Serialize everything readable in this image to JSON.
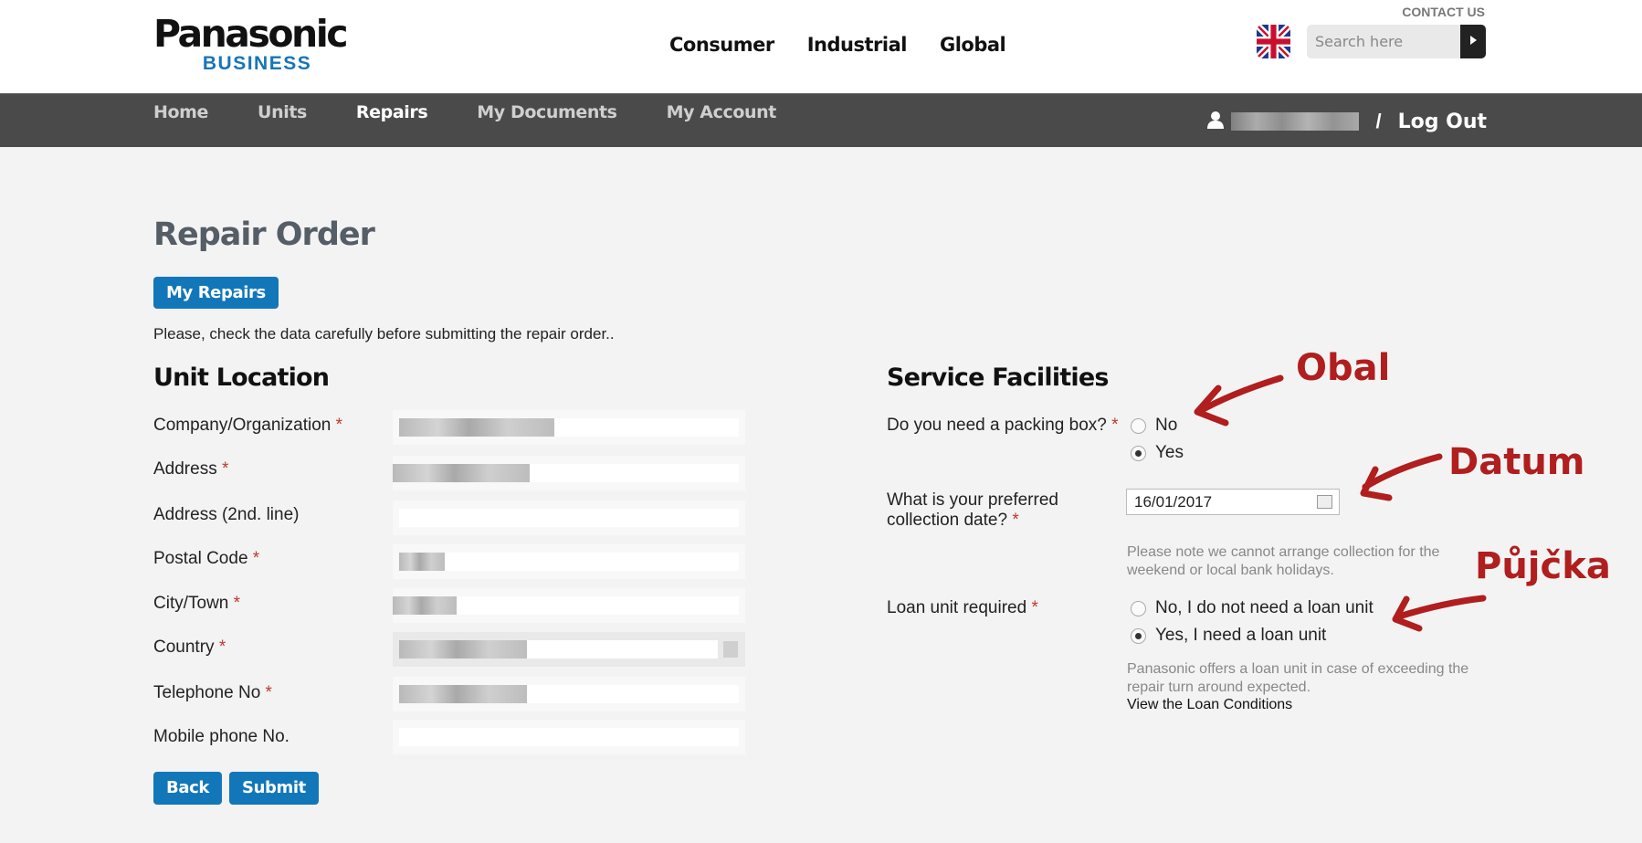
{
  "header": {
    "brand": "Panasonic",
    "brand_sub": "BUSINESS",
    "contact": "CONTACT US",
    "nav": [
      "Consumer",
      "Industrial",
      "Global"
    ],
    "search_placeholder": "Search here"
  },
  "subnav": {
    "items": [
      "Home",
      "Units",
      "Repairs",
      "My Documents",
      "My Account"
    ],
    "active": "Repairs",
    "separator": "/",
    "logout": "Log Out"
  },
  "page": {
    "title": "Repair Order",
    "my_repairs_button": "My Repairs",
    "intro": "Please, check the data carefully before submitting the repair order..",
    "back_button": "Back",
    "submit_button": "Submit"
  },
  "unit_location": {
    "heading": "Unit Location",
    "fields": [
      {
        "label": "Company/Organization",
        "required": "*"
      },
      {
        "label": "Address",
        "required": "*"
      },
      {
        "label": "Address (2nd. line)",
        "required": ""
      },
      {
        "label": "Postal Code",
        "required": "*"
      },
      {
        "label": "City/Town",
        "required": "*"
      },
      {
        "label": "Country",
        "required": "*"
      },
      {
        "label": "Telephone No",
        "required": "*"
      },
      {
        "label": "Mobile phone No.",
        "required": ""
      }
    ]
  },
  "service": {
    "heading": "Service Facilities",
    "packing_label": "Do you need a packing box?",
    "packing_options": [
      "No",
      "Yes"
    ],
    "packing_selected": "Yes",
    "date_label_1": "What is your preferred",
    "date_label_2": "collection date?",
    "date_value": "16/01/2017",
    "date_note_1": "Please note we cannot arrange collection for the",
    "date_note_2": "weekend or local bank holidays.",
    "loan_label": "Loan unit required",
    "loan_options": [
      "No, I do not need a loan unit",
      "Yes, I need a loan unit"
    ],
    "loan_selected": "Yes, I need a loan unit",
    "loan_note_1": "Panasonic offers a loan unit in case of exceeding the",
    "loan_note_2": "repair turn around expected.",
    "loan_link": "View the Loan Conditions",
    "required_mark": "*"
  },
  "annotations": {
    "obal": "Obal",
    "datum": "Datum",
    "pujcka": "Půjčka",
    "color": "#b01e1e"
  },
  "colors": {
    "accent": "#1277b9",
    "nav_bg": "#4a4a4a",
    "required": "#c0392b"
  }
}
